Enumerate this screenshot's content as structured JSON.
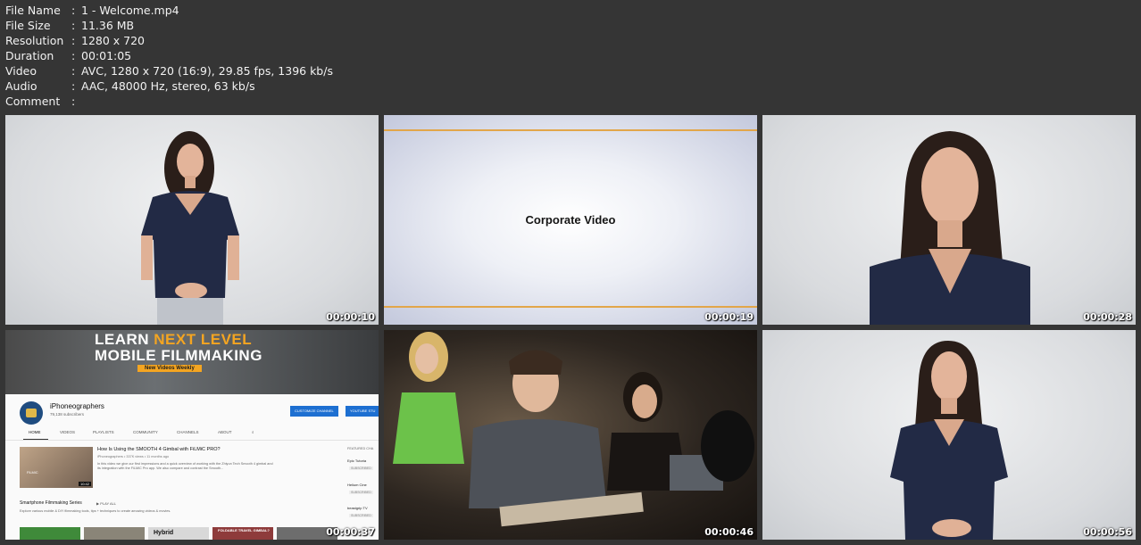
{
  "meta": {
    "rows": [
      {
        "key": "File Name",
        "sep": ":",
        "value": "1 - Welcome.mp4"
      },
      {
        "key": "File Size",
        "sep": ":",
        "value": "11.36 MB"
      },
      {
        "key": "Resolution",
        "sep": ":",
        "value": "1280 x 720"
      },
      {
        "key": "Duration",
        "sep": ":",
        "value": "00:01:05"
      },
      {
        "key": "Video",
        "sep": ":",
        "value": "AVC, 1280 x 720 (16:9), 29.85 fps, 1396 kb/s"
      },
      {
        "key": "Audio",
        "sep": ":",
        "value": "AAC, 48000 Hz, stereo, 63 kb/s"
      },
      {
        "key": "Comment",
        "sep": ":",
        "value": ""
      }
    ]
  },
  "thumbnails": [
    {
      "timestamp": "00:00:10"
    },
    {
      "timestamp": "00:00:19",
      "title": "Corporate Video"
    },
    {
      "timestamp": "00:00:28"
    },
    {
      "timestamp": "00:00:37"
    },
    {
      "timestamp": "00:00:46"
    },
    {
      "timestamp": "00:00:56"
    }
  ],
  "youtube": {
    "banner_line1_a": "LEARN ",
    "banner_line1_b": "NEXT LEVEL",
    "banner_line2": "MOBILE FILMMAKING",
    "banner_line3": "New Videos Weekly",
    "channel_name": "iPhoneographers",
    "subscribers": "79,138 subscribers",
    "customize_button": "CUSTOMIZE CHANNEL",
    "studio_button": "YOUTUBE STU",
    "tabs": [
      "HOME",
      "VIDEOS",
      "PLAYLISTS",
      "COMMUNITY",
      "CHANNELS",
      "ABOUT"
    ],
    "video_title": "How Is Using the SMOOTH 4 Gimbal with FiLMiC PRO?",
    "video_meta": "iPhoneographers • 337K views • 11 months ago",
    "video_desc": "In this video we give our first impressions and a quick overview of working with the Zhiyun Tech Smooth 4 gimbal and its integration with the FiLMiC Pro app. We also compare and contrast the Smooth...",
    "video_duration": "10:42",
    "thumb_text": "FiLMiC",
    "featured_title": "FEATURED CHA",
    "featured": [
      {
        "name": "Epic Tutoria",
        "sub": "SUBSCRIBED"
      },
      {
        "name": "Helium Cine",
        "sub": "SUBSCRIBED"
      },
      {
        "name": "beastgrip TV",
        "sub": "SUBSCRIBED"
      }
    ],
    "section_title": "Smartphone Filmmaking Series",
    "play_all": "▶  PLAY ALL",
    "section_desc": "Explore various mobile & DIY filmmaking tools, tips + techniques to create amazing videos & movies.",
    "strip_label_1": "Hybrid",
    "strip_label_2": "FOLDABLE TRAVEL GIMBAL?"
  }
}
